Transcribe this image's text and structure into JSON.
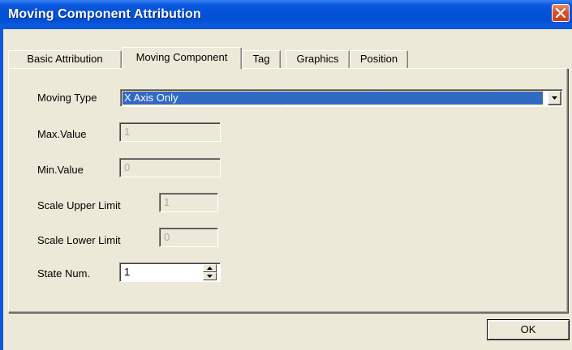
{
  "window": {
    "title": "Moving Component Attribution"
  },
  "tabs": [
    {
      "label": "Basic Attribution",
      "active": false
    },
    {
      "label": "Moving Component",
      "active": true
    },
    {
      "label": "Tag",
      "active": false
    },
    {
      "label": "Graphics",
      "active": false
    },
    {
      "label": "Position",
      "active": false
    }
  ],
  "form": {
    "moving_type": {
      "label": "Moving Type",
      "value": "X Axis Only"
    },
    "max_value": {
      "label": "Max.Value",
      "value": "1"
    },
    "min_value": {
      "label": "Min.Value",
      "value": "0"
    },
    "scale_upper": {
      "label": "Scale Upper Limit",
      "value": "1"
    },
    "scale_lower": {
      "label": "Scale Lower Limit",
      "value": "0"
    },
    "state_num": {
      "label": "State Num.",
      "value": "1"
    }
  },
  "buttons": {
    "ok": "OK"
  },
  "icons": {
    "close": "close-icon",
    "dropdown": "chevron-down-icon",
    "spin_up": "arrow-up-icon",
    "spin_down": "arrow-down-icon"
  },
  "colors": {
    "titlebar": "#0352d8",
    "face": "#ece9d8",
    "selection": "#316ac5",
    "close": "#d8512c"
  }
}
